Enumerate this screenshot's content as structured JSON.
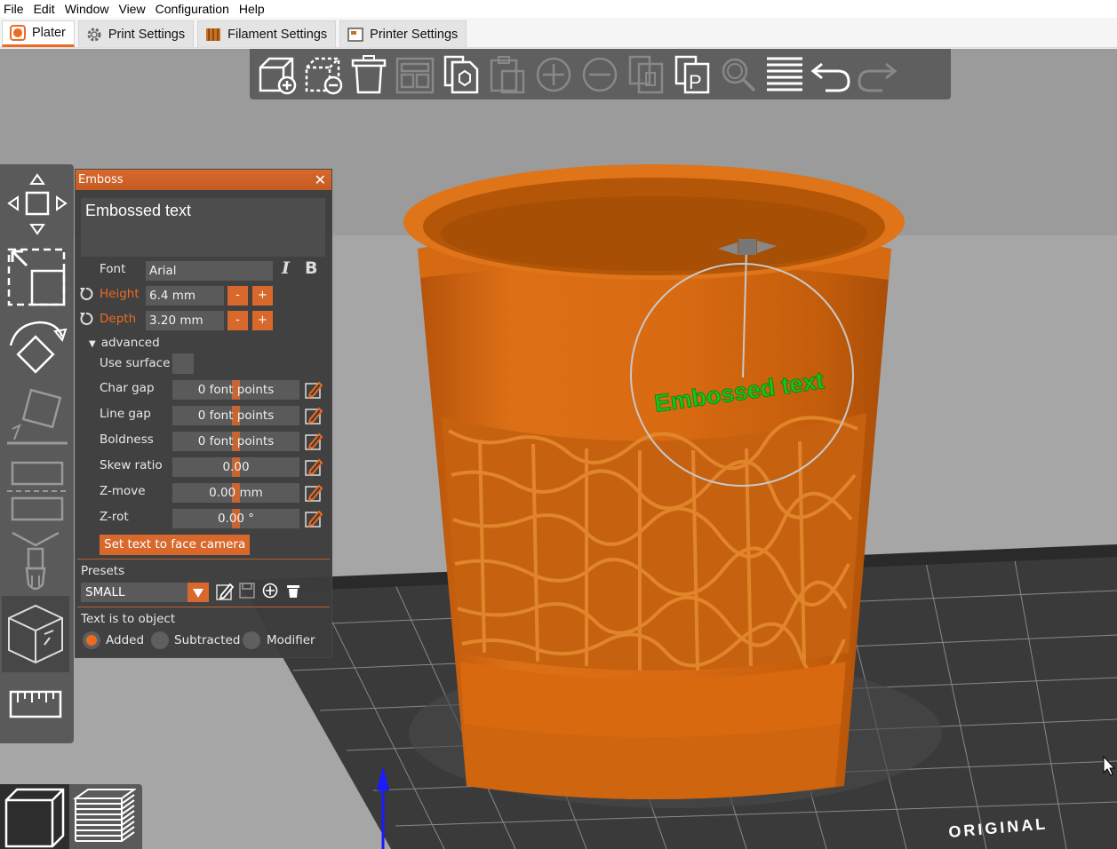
{
  "menu": [
    "File",
    "Edit",
    "Window",
    "View",
    "Configuration",
    "Help"
  ],
  "tabs": [
    {
      "label": "Plater",
      "active": true,
      "icon": "plater-icon"
    },
    {
      "label": "Print Settings",
      "active": false,
      "icon": "gear-icon"
    },
    {
      "label": "Filament Settings",
      "active": false,
      "icon": "filament-spool-icon"
    },
    {
      "label": "Printer Settings",
      "active": false,
      "icon": "printer-icon"
    }
  ],
  "toolbar": {
    "buttons": [
      "add-icon",
      "delete-icon",
      "delete-all-icon",
      "arrange-icon",
      "copy-icon",
      "paste-icon",
      "add-instance-icon",
      "remove-instance-icon",
      "split-to-objects-icon",
      "split-to-parts-icon",
      "search-icon",
      "layers-editing-icon",
      "undo-icon",
      "redo-icon"
    ]
  },
  "emboss": {
    "title": "Emboss",
    "text": "Embossed text",
    "font_label": "Font",
    "font_value": "Arial",
    "height_label": "Height",
    "height_value": "6.4 mm",
    "depth_label": "Depth",
    "depth_value": "3.20 mm",
    "minus": "-",
    "plus": "+",
    "advanced_label": "advanced",
    "use_surface_label": "Use surface",
    "char_gap_label": "Char gap",
    "char_gap_value": "0 font points",
    "line_gap_label": "Line gap",
    "line_gap_value": "0 font points",
    "boldness_label": "Boldness",
    "boldness_value": "0 font points",
    "skew_label": "Skew ratio",
    "skew_value": "0.00",
    "zmove_label": "Z-move",
    "zmove_value": "0.00 mm",
    "zrot_label": "Z-rot",
    "zrot_value": "0.00 °",
    "face_camera_button": "Set text to face camera",
    "presets_label": "Presets",
    "preset_value": "SMALL",
    "text_is_to_object": "Text is to object",
    "mode_added": "Added",
    "mode_subtracted": "Subtracted",
    "mode_modifier": "Modifier",
    "selected_mode": "Added"
  },
  "scene": {
    "embossed_preview_text": "Embossed text",
    "bed_logo_text": "ORIGINAL",
    "object_color": "#d9690f",
    "text_color": "#1fc21f"
  },
  "colors": {
    "accent": "#ed6b21",
    "panel": "#3c3c3c"
  }
}
